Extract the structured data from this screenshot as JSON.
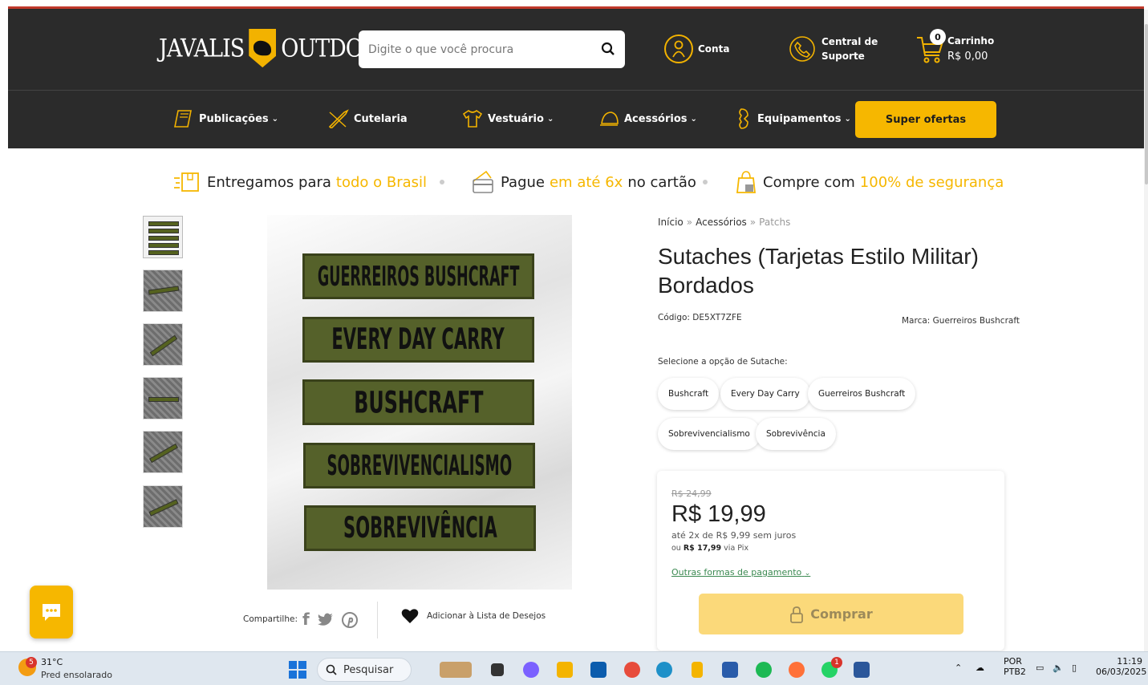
{
  "header": {
    "logo_left": "JAVALIS",
    "logo_right": "OUTDOOR",
    "search_placeholder": "Digite o que você procura",
    "account_label": "Conta",
    "support_line1": "Central de",
    "support_line2": "Suporte",
    "cart_label": "Carrinho",
    "cart_total": "R$ 0,00",
    "cart_count": "0"
  },
  "nav": {
    "items": [
      {
        "label": "Publicações"
      },
      {
        "label": "Cutelaria"
      },
      {
        "label": "Vestuário"
      },
      {
        "label": "Acessórios"
      },
      {
        "label": "Equipamentos"
      }
    ],
    "super_offers": "Super ofertas"
  },
  "benefits": {
    "b1_pre": "Entregamos para ",
    "b1_hl": "todo o Brasil",
    "b2_pre": "Pague ",
    "b2_hl": "em até 6x",
    "b2_post": " no cartão",
    "b3_pre": "Compre com ",
    "b3_hl": "100% de segurança"
  },
  "product": {
    "breadcrumb": [
      "Início",
      "Acessórios",
      "Patchs"
    ],
    "title": "Sutaches (Tarjetas Estilo Militar) Bordados",
    "code": "Código: DE5XT7ZFE",
    "brand": "Marca: Guerreiros Bushcraft",
    "option_label": "Selecione a opção de Sutache:",
    "options": [
      "Bushcraft",
      "Every Day Carry",
      "Guerreiros Bushcraft",
      "Sobrevivencialismo",
      "Sobrevivência"
    ],
    "patches": [
      "GUERREIROS BUSHCRAFT",
      "EVERY DAY CARRY",
      "BUSHCRAFT",
      "SOBREVIVENCIALISMO",
      "SOBREVIVÊNCIA"
    ],
    "old_price": "R$ 24,99",
    "price": "R$ 19,99",
    "installments": "até 2x de R$ 9,99 sem juros",
    "pix_pre": "ou ",
    "pix_value": "R$ 17,99",
    "pix_post": " via Pix",
    "other_payments": "Outras formas de pagamento",
    "buy": "Comprar",
    "share": "Compartilhe:",
    "wishlist": "Adicionar à Lista de Desejos"
  },
  "taskbar": {
    "weather_badge": "5",
    "temp": "31°C",
    "weather": "Pred ensolarado",
    "search": "Pesquisar",
    "lang1": "POR",
    "lang2": "PTB2",
    "time": "11:19",
    "date": "06/03/2025",
    "whatsapp_badge": "1"
  },
  "colors": {
    "brand_dark": "#2b2b2b",
    "accent_yellow": "#f6b700",
    "patch_green": "#55612a",
    "link_green": "#3c8a52"
  }
}
